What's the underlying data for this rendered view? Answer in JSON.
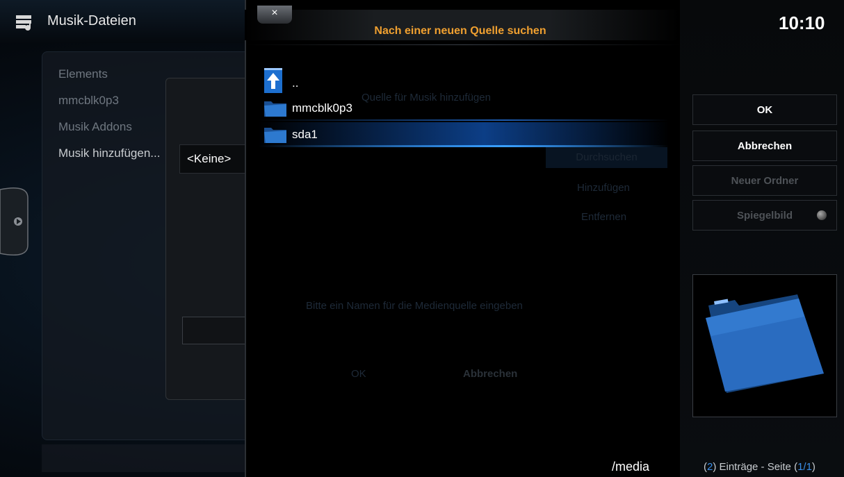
{
  "app": {
    "title": "Musik-Dateien",
    "clock": "10:10"
  },
  "left_list": {
    "items": [
      "Elements",
      "mmcblk0p3",
      "Musik Addons",
      "Musik hinzufügen..."
    ],
    "dropdown_value": "<Keine>"
  },
  "dialog": {
    "close_label": "×",
    "title": "Nach einer neuen Quelle suchen",
    "entries": [
      {
        "label": "..",
        "icon": "folder-up-icon"
      },
      {
        "label": "mmcblk0p3",
        "icon": "folder-icon"
      },
      {
        "label": "sda1",
        "icon": "folder-icon"
      }
    ],
    "current_path": "/media"
  },
  "background_dialog": {
    "title": "Quelle für Musik hinzufügen",
    "buttons": [
      "Durchsuchen",
      "Hinzufügen",
      "Entfernen"
    ],
    "hint": "Bitte ein Namen für die Medienquelle eingeben",
    "footer_buttons": [
      "OK",
      "Abbrechen"
    ]
  },
  "right_panel": {
    "buttons": [
      {
        "label": "OK",
        "enabled": true
      },
      {
        "label": "Abbrechen",
        "enabled": true
      },
      {
        "label": "Neuer Ordner",
        "enabled": false
      },
      {
        "label": "Spiegelbild",
        "enabled": false
      }
    ],
    "thumbnail_icon": "folder-thumbnail-icon",
    "footer": {
      "count": "2",
      "text_mid": ") Einträge - Seite (",
      "page": "1/1",
      "open": "(",
      "close": ")"
    }
  },
  "colors": {
    "accent": "#f0a030",
    "selection": "#0c3e86",
    "link": "#3a8ee8"
  }
}
